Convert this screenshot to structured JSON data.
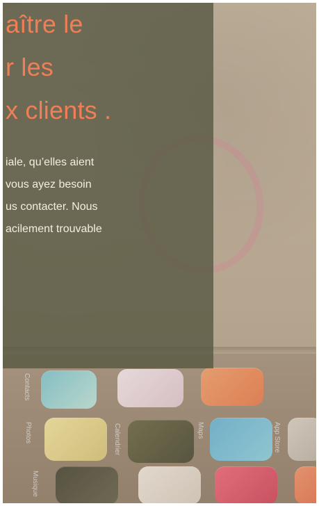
{
  "hero": {
    "headline": "aître le\nr les\nx clients .",
    "paragraph": "iale, qu’elles aient\n vous ayez besoin\nus contacter. Nous\nacilement trouvable"
  },
  "apps": {
    "labels": [
      "Contacts",
      "Photos",
      "Calendrier",
      "Maps",
      "App Store",
      "Musique"
    ]
  },
  "colors": {
    "overlay": "#545640",
    "headline": "#f07f58",
    "paragraph": "#f2eee2"
  }
}
